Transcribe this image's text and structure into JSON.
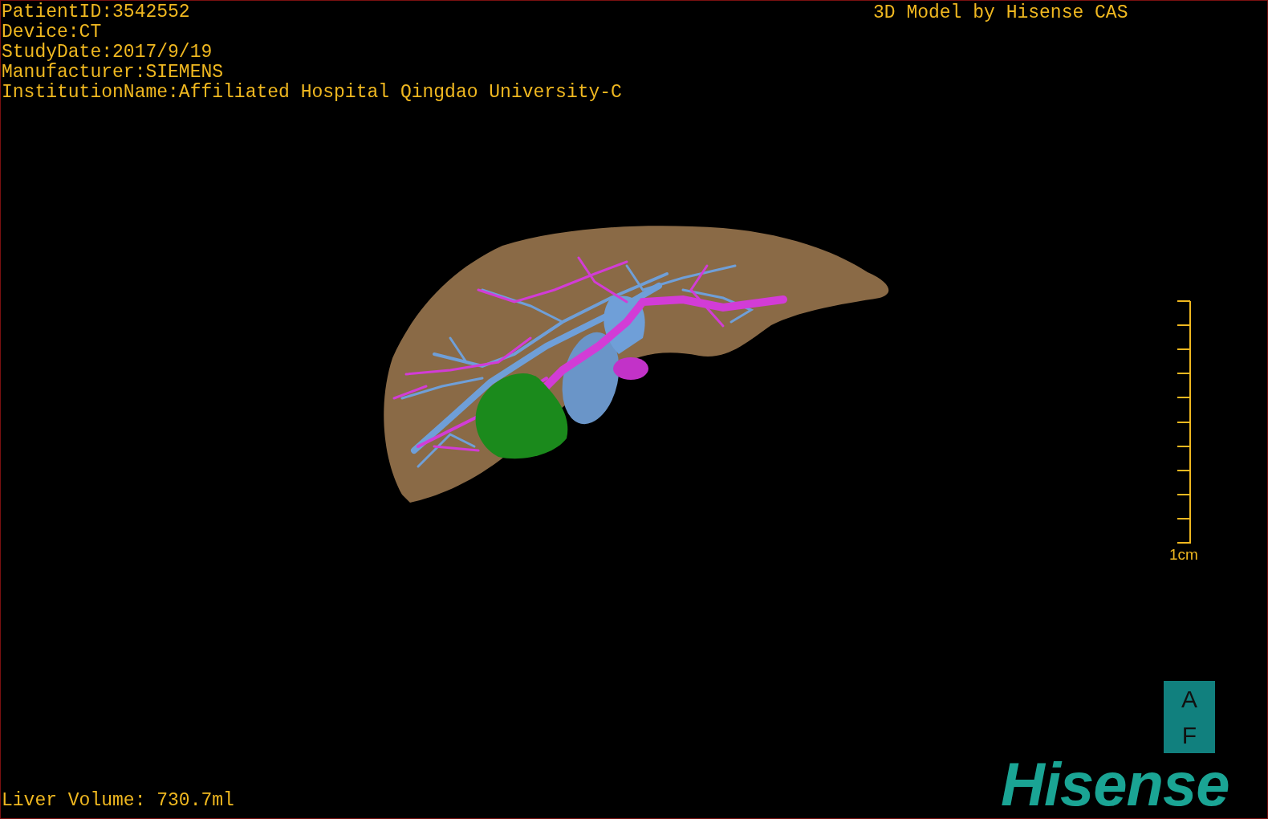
{
  "viewer": {
    "info_lines": [
      "PatientID:3542552",
      "Device:CT",
      "StudyDate:2017/9/19",
      "Manufacturer:SIEMENS",
      "InstitutionName:Affiliated Hospital Qingdao University-C"
    ],
    "title": "3D Model by Hisense CAS",
    "scale_bar": {
      "label": "1cm"
    },
    "orientation_marker": {
      "labels": [
        "A",
        "F"
      ]
    },
    "measurement": "Liver Volume: 730.7ml",
    "logo": "Hisense"
  }
}
